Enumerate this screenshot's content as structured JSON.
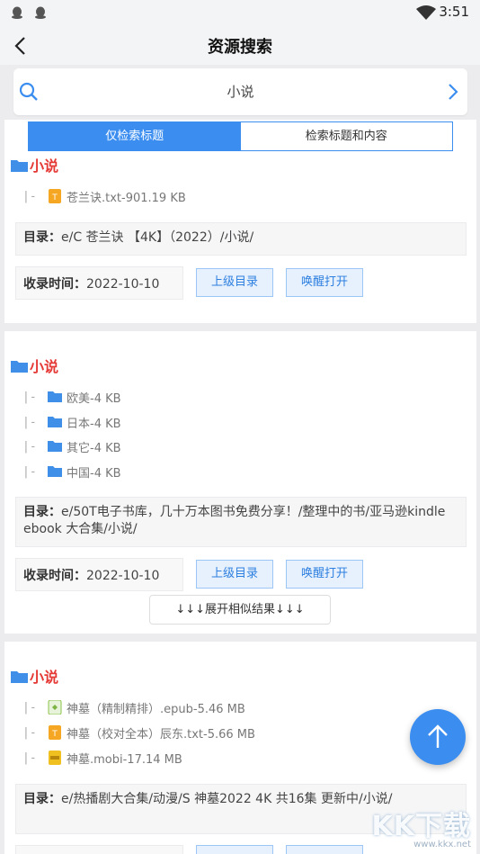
{
  "status_bar": {
    "time": "3:51"
  },
  "app_bar": {
    "title": "资源搜索"
  },
  "search": {
    "query": "小说"
  },
  "segment": {
    "options": [
      "仅检索标题",
      "检索标题和内容"
    ]
  },
  "labels": {
    "dir": "目录：",
    "time": "收录时间："
  },
  "results": [
    {
      "title": "小说",
      "files": [
        {
          "branch": "|-",
          "icon": "txt-file-icon",
          "name": "苍兰诀.txt-901.19 KB"
        }
      ],
      "dir": "e/C 苍兰诀 【4K】（2022）/小说/",
      "date": "2022-10-10",
      "parent_button": "上级目录",
      "open_button": "唤醒打开"
    },
    {
      "title": "小说",
      "files": [
        {
          "branch": "|-",
          "icon": "folder-icon",
          "name": "欧美-4 KB"
        },
        {
          "branch": "|-",
          "icon": "folder-icon",
          "name": "日本-4 KB"
        },
        {
          "branch": "|-",
          "icon": "folder-icon",
          "name": "其它-4 KB"
        },
        {
          "branch": "|-",
          "icon": "folder-icon",
          "name": "中国-4 KB"
        }
      ],
      "dir": "e/50T电子书库，几十万本图书免费分享！/整理中的书/亚马逊kindle ebook 大合集/小说/",
      "date": "2022-10-10",
      "parent_button": "上级目录",
      "open_button": "唤醒打开",
      "expand_button": "↓↓↓展开相似结果↓↓↓"
    },
    {
      "title": "小说",
      "files": [
        {
          "branch": "|-",
          "icon": "epub-file-icon",
          "name": "神墓（精制精排）.epub-5.46 MB"
        },
        {
          "branch": "|-",
          "icon": "txt-file-icon",
          "name": "神墓（校对全本）辰东.txt-5.66 MB"
        },
        {
          "branch": "|-",
          "icon": "mobi-file-icon",
          "name": "神墓.mobi-17.14 MB"
        }
      ],
      "dir": "e/热播剧大合集/动漫/S 神墓2022 4K 共16集 更新中/小说/"
    }
  ],
  "watermark": {
    "logo": "KK下载",
    "url": "www.kkx.net"
  },
  "colors": {
    "accent": "#3b8ef0",
    "title_red": "#e53935",
    "folder_blue": "#3f8ee8"
  }
}
